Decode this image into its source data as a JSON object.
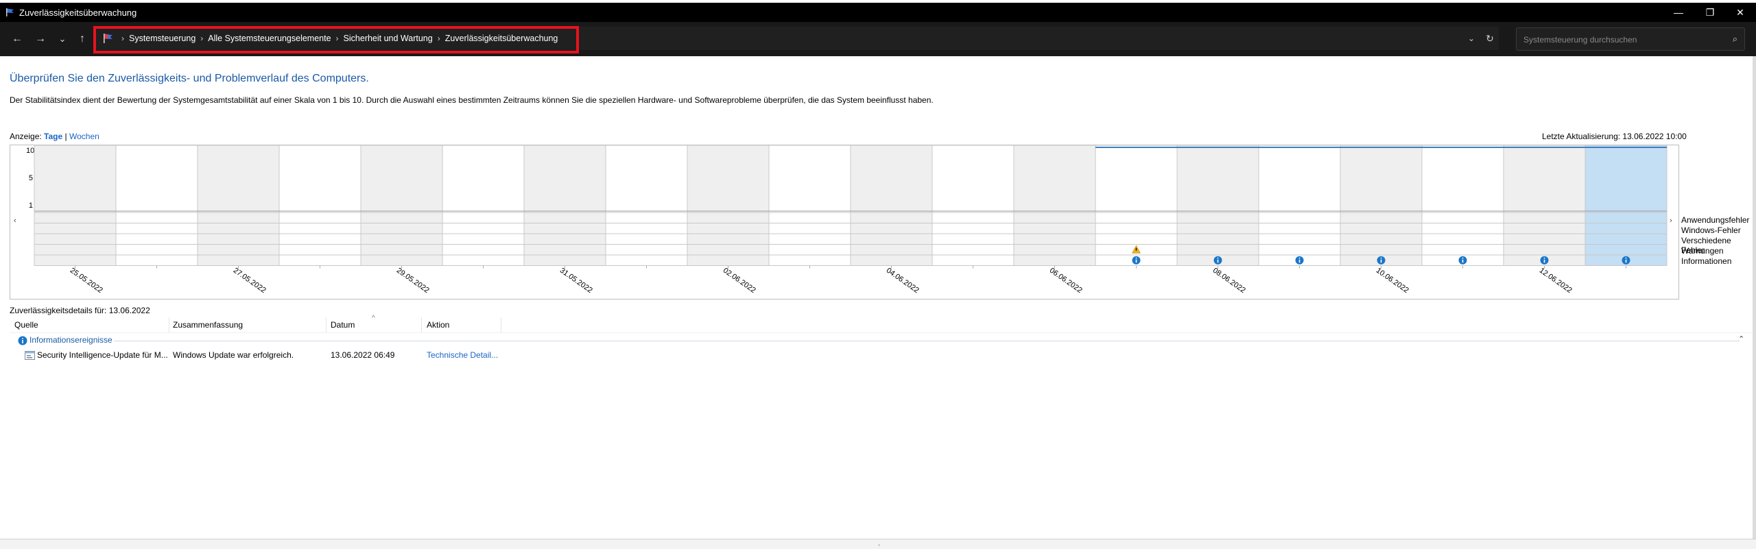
{
  "window": {
    "title": "Zuverlässigkeitsüberwachung",
    "controls": {
      "minimize": "—",
      "restore": "❐",
      "close": "✕"
    }
  },
  "nav": {
    "back": "←",
    "forward": "→",
    "recent": "⌄",
    "up": "↑",
    "breadcrumbs": [
      "Systemsteuerung",
      "Alle Systemsteuerungselemente",
      "Sicherheit und Wartung",
      "Zuverlässigkeitsüberwachung"
    ],
    "separator": "›",
    "dropdown": "⌄",
    "refresh": "↻",
    "search_placeholder": "Systemsteuerung durchsuchen",
    "search_icon": "⌕",
    "highlight_color": "#e8121d"
  },
  "content": {
    "heading": "Überprüfen Sie den Zuverlässigkeits- und Problemverlauf des Computers.",
    "description": "Der Stabilitätsindex dient der Bewertung der Systemgesamtstabilität auf einer Skala von 1 bis 10. Durch die Auswahl eines bestimmten Zeitraums können Sie die speziellen Hardware- und Softwareprobleme überprüfen, die das System beeinflusst haben.",
    "view_label": "Anzeige:",
    "view_days": "Tage",
    "view_sep": "|",
    "view_weeks": "Wochen",
    "last_update": "Letzte Aktualisierung: 13.06.2022 10:00"
  },
  "chart_data": {
    "type": "table",
    "y_ticks": [
      "10",
      "5",
      "1"
    ],
    "ylim": [
      1,
      10
    ],
    "x_labels": [
      "25.05.2022",
      "27.05.2022",
      "29.05.2022",
      "31.05.2022",
      "02.06.2022",
      "04.06.2022",
      "06.06.2022",
      "08.06.2022",
      "10.06.2022",
      "12.06.2022"
    ],
    "columns": 20,
    "selected_column": 19,
    "stability_line_from_column": 13,
    "stability_value": 10,
    "event_rows": [
      "Anwendungsfehler",
      "Windows-Fehler",
      "Verschiedene Fehler",
      "Warnungen",
      "Informationen"
    ],
    "warnings": [
      13
    ],
    "informations": [
      13,
      14,
      15,
      16,
      17,
      18,
      19
    ],
    "arrow_left": "‹",
    "arrow_right": "›",
    "colors": {
      "shaded": "#efefef",
      "selected": "#c4def3",
      "grid": "#c8c8c8",
      "line": "#3c7fc6",
      "info": "#1a76c9",
      "warning": "#f2b01e"
    }
  },
  "details": {
    "title": "Zuverlässigkeitsdetails für: 13.06.2022",
    "sort_indicator": "^",
    "columns": [
      "Quelle",
      "Zusammenfassung",
      "Datum",
      "Aktion"
    ],
    "group": "Informationsereignisse",
    "group_icon": "i",
    "collapse": "⌃",
    "rows": [
      {
        "source": "Security Intelligence-Update für M...",
        "summary": "Windows Update war erfolgreich.",
        "date": "13.06.2022 06:49",
        "action": "Technische Detail..."
      }
    ]
  },
  "status": {
    "grip": "◦"
  }
}
